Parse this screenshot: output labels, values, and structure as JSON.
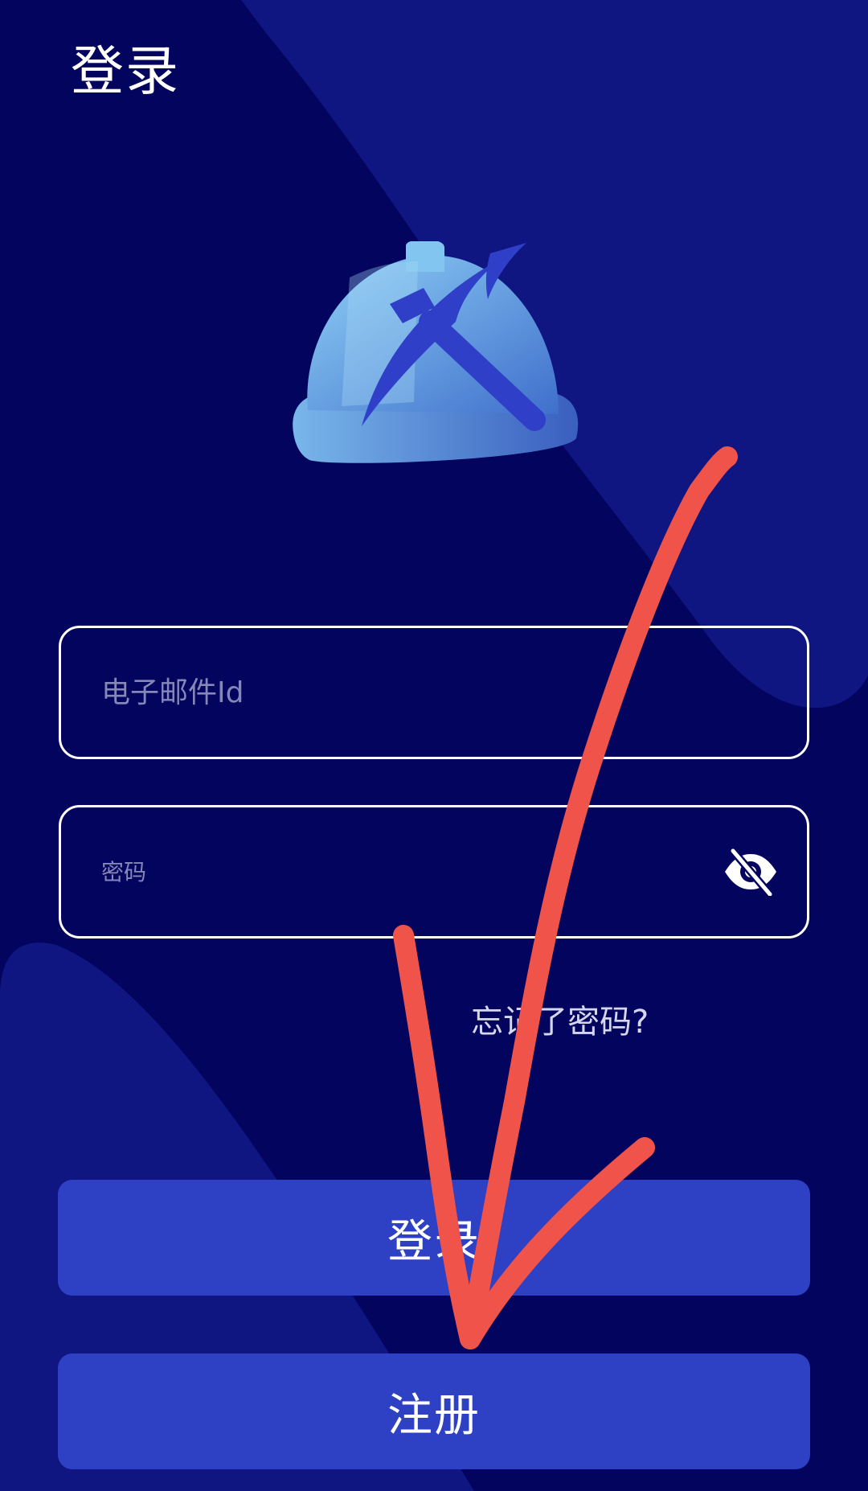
{
  "header": {
    "title": "登录"
  },
  "form": {
    "email_placeholder": "电子邮件Id",
    "email_value": "",
    "password_placeholder": "密码",
    "password_value": ""
  },
  "links": {
    "forgot_password": "忘记了密码?"
  },
  "buttons": {
    "login_label": "登录",
    "register_label": "注册"
  },
  "icons": {
    "logo": "hardhat-pickaxe-icon",
    "password_toggle": "eye-off-icon"
  },
  "colors": {
    "background": "#03045e",
    "button": "#2e40c4",
    "annotation": "#f0534a"
  }
}
